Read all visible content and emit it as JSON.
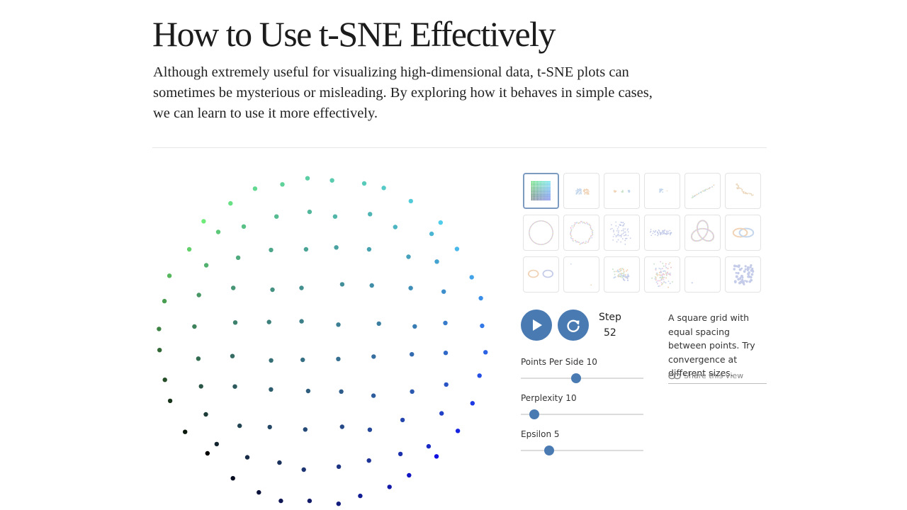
{
  "article": {
    "title": "How to Use t-SNE Effectively",
    "lede": "Although extremely useful for visualizing high-dimensional data, t-SNE plots can sometimes be mysterious or misleading. By exploring how it behaves in simple cases, we can learn to use it more effectively."
  },
  "controls": {
    "play_icon": "play-icon",
    "restart_icon": "restart-icon",
    "step_label": "Step",
    "step_value": "52",
    "description": "A square grid with equal spacing between points. Try convergence at different sizes.",
    "share_label": "Share this view",
    "share_icon": "link-icon",
    "sliders": [
      {
        "name": "points-per-side",
        "label": "Points Per Side 10",
        "fraction": 0.45
      },
      {
        "name": "perplexity",
        "label": "Perplexity 10",
        "fraction": 0.11
      },
      {
        "name": "epsilon",
        "label": "Epsilon 5",
        "fraction": 0.23
      }
    ]
  },
  "colors": {
    "accent": "#4a7ab2",
    "thumb_border_selected": "#7d9bc1",
    "rule": "#e6e6e6"
  },
  "thumbnails": [
    {
      "name": "square-grid",
      "selected": true
    },
    {
      "name": "two-clusters"
    },
    {
      "name": "three-clusters"
    },
    {
      "name": "small-cluster"
    },
    {
      "name": "parallel-lines"
    },
    {
      "name": "random-walk"
    },
    {
      "name": "circle"
    },
    {
      "name": "noisy-circle"
    },
    {
      "name": "gaussian-cloud"
    },
    {
      "name": "elongated-gaussian"
    },
    {
      "name": "trefoil"
    },
    {
      "name": "linked-rings"
    },
    {
      "name": "unlinked-rings"
    },
    {
      "name": "sparse-points"
    },
    {
      "name": "subset-clusters"
    },
    {
      "name": "mixed-clusters"
    },
    {
      "name": "single-point"
    },
    {
      "name": "blob-cluster"
    }
  ]
}
